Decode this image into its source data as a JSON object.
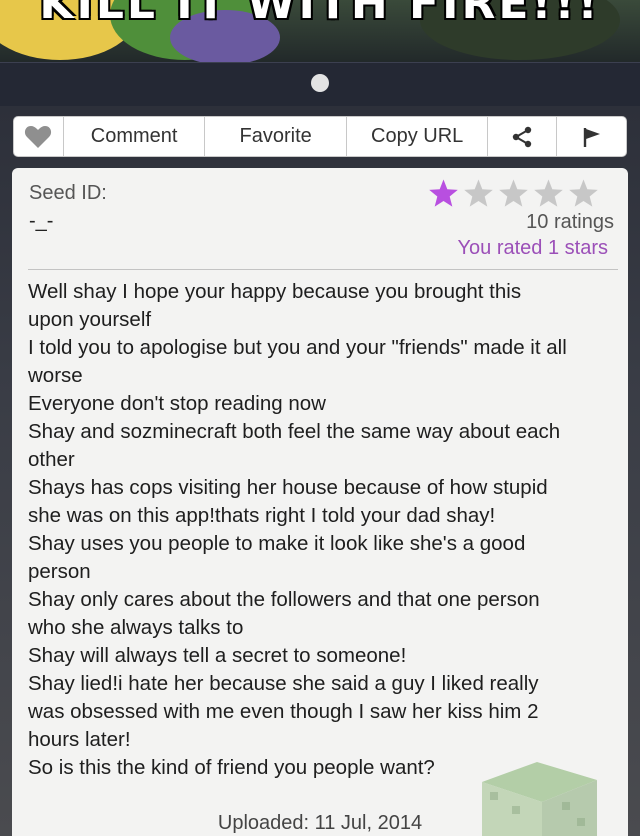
{
  "banner": {
    "text": "KILL IT WITH FIRE!!!"
  },
  "actions": {
    "like_icon": "heart-icon",
    "comment": "Comment",
    "favorite": "Favorite",
    "copy_url": "Copy URL",
    "share_icon": "share-icon",
    "flag_icon": "flag-icon"
  },
  "seed": {
    "label": "Seed ID:",
    "value": "-_-"
  },
  "rating": {
    "filled_stars": 1,
    "total_stars": 5,
    "star_color": "#b84fe0",
    "empty_star_color": "#c7c7c7",
    "count_text": "10 ratings",
    "you_rated": "You rated 1 stars"
  },
  "post": {
    "lines": [
      "Well shay I hope your happy because you brought this",
      "upon yourself",
      "I told you to apologise but you and your \"friends\" made it all",
      "worse",
      "Everyone don't stop reading now",
      "Shay and sozminecraft both feel the same way about each",
      "other",
      "Shays has cops visiting her house because of how stupid",
      "she was on this app!thats right I told your dad shay!",
      "Shay uses you people to make it look like she's a good",
      "person",
      "Shay only cares about the followers and that one person",
      "who she always talks to",
      "Shay will always tell a secret to someone!",
      "Shay lied!i hate her because she said a guy I liked really",
      "was obsessed with me even though I saw her kiss him 2",
      "hours later!",
      "So is this the kind of friend you people want?"
    ],
    "uploaded": "Uploaded: 11 Jul, 2014"
  },
  "colors": {
    "accent": "#9b4fb8",
    "card_bg": "#f3f3f2",
    "page_bg": "#2c2e36"
  }
}
